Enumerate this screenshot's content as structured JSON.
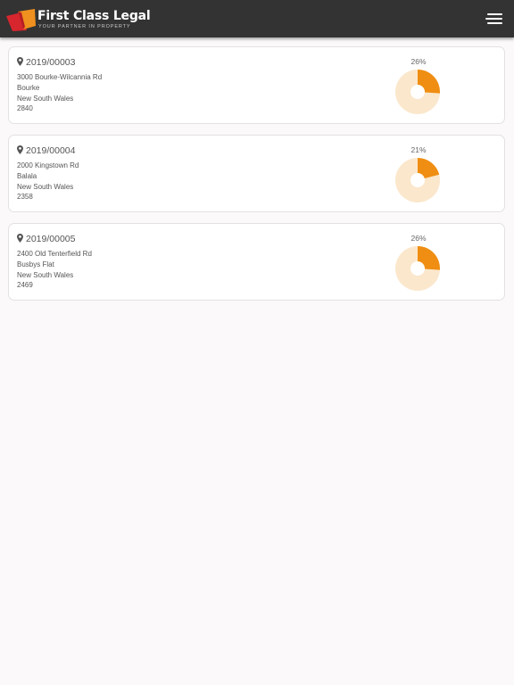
{
  "header": {
    "brand": "First Class Legal",
    "tagline": "YOUR PARTNER IN PROPERTY",
    "colors": {
      "bar": "#333333",
      "logo_red": "#d7262e",
      "logo_orange": "#f0901e"
    }
  },
  "menu": {
    "icon": "hamburger-menu-icon"
  },
  "colors": {
    "progress": "#ef8e12",
    "progress_track": "#fbe7cc"
  },
  "properties": [
    {
      "reference": "2019/00003",
      "address": [
        "3000 Bourke-Wilcannia Rd",
        "Bourke",
        "New South Wales",
        "2840"
      ],
      "progress_label": "26%",
      "progress": 0.26
    },
    {
      "reference": "2019/00004",
      "address": [
        "2000 Kingstown Rd",
        "Balala",
        "New South Wales",
        "2358"
      ],
      "progress_label": "21%",
      "progress": 0.21
    },
    {
      "reference": "2019/00005",
      "address": [
        "2400 Old Tenterfield Rd",
        "Busbys Flat",
        "New South Wales",
        "2469"
      ],
      "progress_label": "26%",
      "progress": 0.26
    }
  ]
}
